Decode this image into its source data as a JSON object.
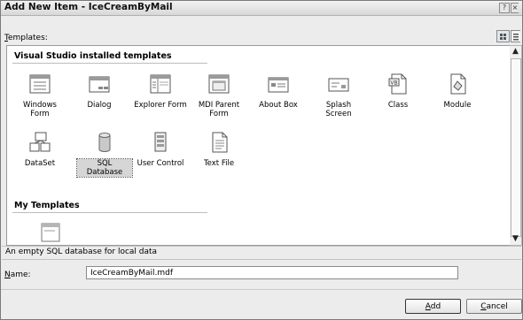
{
  "window": {
    "title": "Add New Item - IceCreamByMail"
  },
  "templates_label": "Templates:",
  "groups": [
    {
      "label": "Visual Studio installed templates"
    },
    {
      "label": "My Templates"
    }
  ],
  "items": [
    {
      "label": "Windows Form",
      "icon": "windows-form-icon"
    },
    {
      "label": "Dialog",
      "icon": "dialog-icon"
    },
    {
      "label": "Explorer Form",
      "icon": "explorer-form-icon"
    },
    {
      "label": "MDI Parent Form",
      "icon": "mdi-parent-form-icon"
    },
    {
      "label": "About Box",
      "icon": "about-box-icon"
    },
    {
      "label": "Splash Screen",
      "icon": "splash-screen-icon"
    },
    {
      "label": "Class",
      "icon": "class-file-icon"
    },
    {
      "label": "Module",
      "icon": "module-icon"
    },
    {
      "label": "DataSet",
      "icon": "dataset-icon"
    },
    {
      "label": "SQL Database",
      "icon": "database-cylinder-icon"
    },
    {
      "label": "User Control",
      "icon": "user-control-icon"
    },
    {
      "label": "Text File",
      "icon": "text-file-icon"
    }
  ],
  "selected_item": "SQL Database",
  "status_text": "An empty SQL database for local data",
  "name": {
    "label": "Name:",
    "value": "IceCreamByMail.mdf"
  },
  "buttons": {
    "add": "Add",
    "cancel": "Cancel"
  }
}
